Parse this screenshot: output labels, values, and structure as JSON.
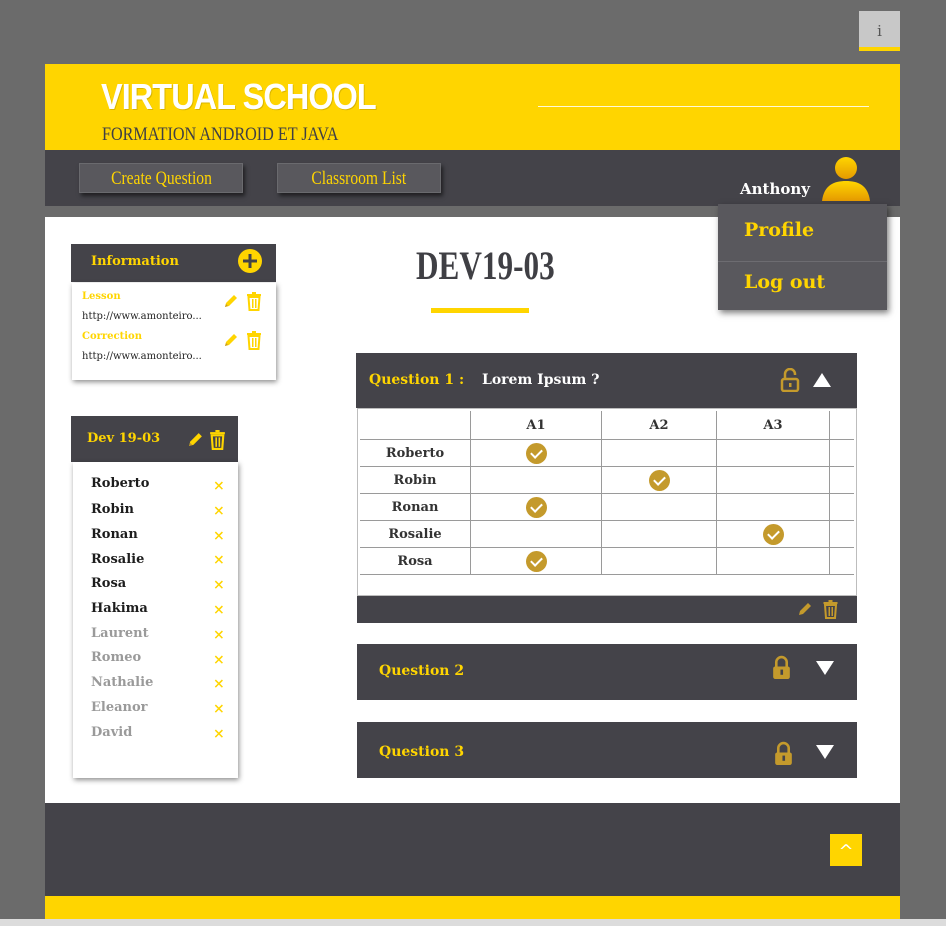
{
  "top": {
    "info_label": "i"
  },
  "brand": {
    "title": "VIRTUAL SCHOOL",
    "subtitle": "FORMATION ANDROID ET JAVA"
  },
  "nav": {
    "create_question": "Create Question",
    "classroom_list": "Classroom List"
  },
  "user": {
    "name": "Anthony",
    "menu": [
      "Profile",
      "Log out"
    ]
  },
  "info_panel": {
    "title": "Information",
    "items": [
      {
        "label": "Lesson",
        "url": "http://www.amonteiro..."
      },
      {
        "label": "Correction",
        "url": "http://www.amonteiro..."
      }
    ]
  },
  "class_panel": {
    "title": "Dev 19-03",
    "students": [
      {
        "name": "Roberto",
        "present": true
      },
      {
        "name": "Robin",
        "present": true
      },
      {
        "name": "Ronan",
        "present": true
      },
      {
        "name": "Rosalie",
        "present": true
      },
      {
        "name": "Rosa",
        "present": true
      },
      {
        "name": "Hakima",
        "present": true
      },
      {
        "name": "Laurent",
        "present": false
      },
      {
        "name": "Romeo",
        "present": false
      },
      {
        "name": "Nathalie",
        "present": false
      },
      {
        "name": "Eleanor",
        "present": false
      },
      {
        "name": "David",
        "present": false
      }
    ],
    "remove_glyph": "×"
  },
  "page": {
    "title": "DEV19-03"
  },
  "questions": [
    {
      "label": "Question 1 :",
      "text": "Lorem Ipsum ?",
      "expanded": true,
      "answers": [
        "A1",
        "A2",
        "A3"
      ],
      "rows": [
        {
          "student": "Roberto",
          "answer": 0
        },
        {
          "student": "Robin",
          "answer": 1
        },
        {
          "student": "Ronan",
          "answer": 0
        },
        {
          "student": "Rosalie",
          "answer": 2
        },
        {
          "student": "Rosa",
          "answer": 0
        }
      ]
    },
    {
      "label": "Question 2",
      "expanded": false
    },
    {
      "label": "Question 3",
      "expanded": false
    }
  ],
  "footer": {
    "to_top": "^"
  },
  "colors": {
    "accent": "#ffd500",
    "dark": "#444349",
    "gold": "#c49a2c",
    "bg": "#6b6b6b"
  }
}
